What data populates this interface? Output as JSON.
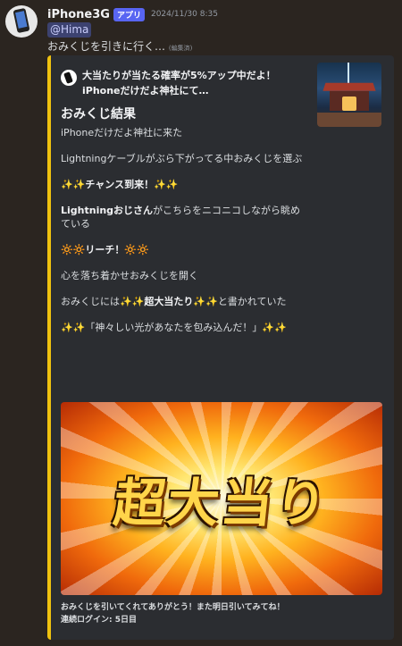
{
  "message": {
    "username": "iPhone3G",
    "app_badge": "アプリ",
    "timestamp": "2024/11/30 8:35",
    "mention": "@Hima",
    "text": "おみくじを引きに行く…",
    "edited": "(編集済)"
  },
  "embed": {
    "accent_color": "#f0c20f",
    "author_line1": "大当たりが当たる確率が5%アップ中だよ！",
    "author_line2": "iPhoneだけだよ神社にて…",
    "title": "おみくじ結果",
    "lines": {
      "l1": "iPhoneだけだよ神社に来た",
      "l2": "Lightningケーブルがぶら下がってる中おみくじを選ぶ",
      "l3_icon": "✨✨",
      "l3_text": "チャンス到来！",
      "l3_icon_end": "✨✨",
      "l4_bold": "Lightningおじさん",
      "l4_text": "がこちらをニコニコしながら眺めている",
      "l5_icon": "🔆🔆",
      "l5_text": "リーチ！",
      "l5_icon_end": "🔆🔆",
      "l6": "心を落ち着かせおみくじを開く",
      "l7_a": "おみくじには",
      "l7_icon": "✨✨",
      "l7_bold": "超大当たり",
      "l7_icon_end": "✨✨",
      "l7_b": "と書かれていた",
      "l8_icon": "✨✨",
      "l8_text": "「神々しい光があなたを包み込んだ！」",
      "l8_icon_end": "✨✨"
    },
    "image_text": "超大当り",
    "footer_line1": "おみくじを引いてくれてありがとう！また明日引いてみてね！",
    "footer_line2": "連続ログイン: 5日目"
  }
}
